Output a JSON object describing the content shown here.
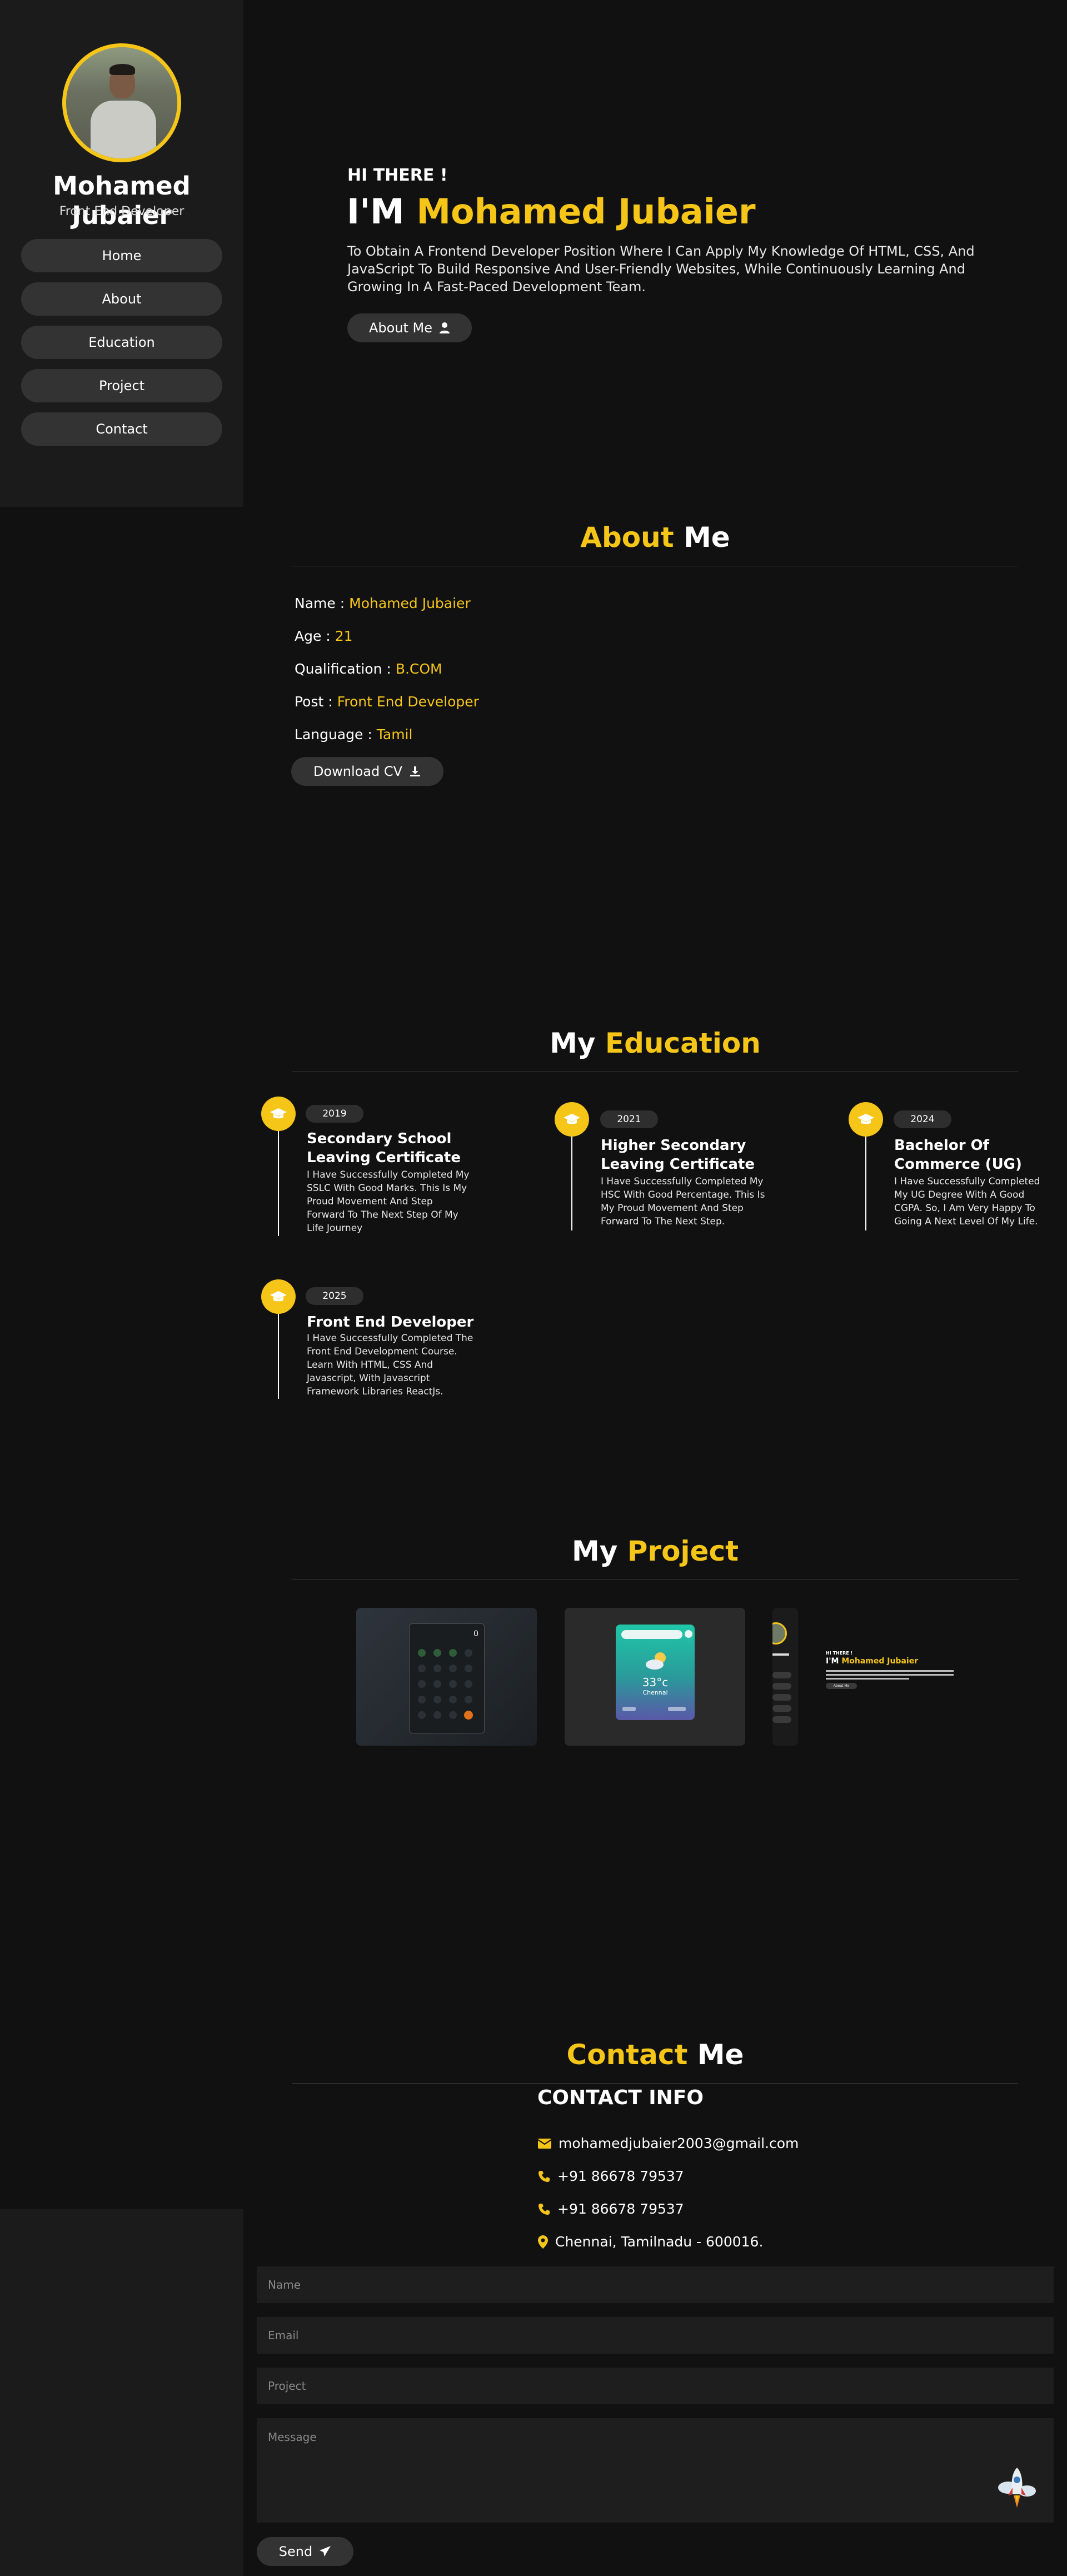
{
  "sidebar": {
    "name": "Mohamed Jubaier",
    "role": "Front End Developer",
    "nav": [
      "Home",
      "About",
      "Education",
      "Project",
      "Contact"
    ]
  },
  "hero": {
    "greeting": "HI THERE !",
    "title_prefix": "I'M",
    "title_name": "Mohamed Jubaier",
    "description": "To Obtain A Frontend Developer Position Where I Can Apply My Knowledge Of HTML, CSS, And JavaScript To Build Responsive And User-Friendly Websites, While Continuously Learning And Growing In A Fast-Paced Development Team.",
    "button": "About Me"
  },
  "about": {
    "title_accent": "About",
    "title_rest": "Me",
    "rows": [
      {
        "label": "Name :",
        "value": "Mohamed Jubaier"
      },
      {
        "label": "Age :",
        "value": "21"
      },
      {
        "label": "Qualification :",
        "value": "B.COM"
      },
      {
        "label": "Post :",
        "value": "Front End Developer"
      },
      {
        "label": "Language :",
        "value": "Tamil"
      }
    ],
    "download_button": "Download CV"
  },
  "education": {
    "title_rest": "My",
    "title_accent": "Education",
    "items": [
      {
        "year": "2019",
        "title": "Secondary School Leaving Certificate",
        "text": "I Have Successfully Completed My SSLC With Good Marks. This Is My Proud Movement And Step Forward To The Next Step Of My Life Journey"
      },
      {
        "year": "2021",
        "title": "Higher Secondary Leaving Certificate",
        "text": "I Have Successfully Completed My HSC With Good Percentage. This Is My Proud Movement And Step Forward To The Next Step."
      },
      {
        "year": "2024",
        "title": "Bachelor Of Commerce (UG)",
        "text": "I Have Successfully Completed My UG Degree With A Good CGPA. So, I Am Very Happy To Going A Next Level Of My Life."
      },
      {
        "year": "2025",
        "title": "Front End Developer",
        "text": "I Have Successfully Completed The Front End Development Course. Learn With HTML, CSS And Javascript, With Javascript Framework Libraries ReactJs."
      }
    ]
  },
  "projects": {
    "title_rest": "My",
    "title_accent": "Project",
    "calculator_display": "0",
    "weather_temp": "33°c",
    "weather_city": "Chennai",
    "portfolio_greeting": "HI THERE !",
    "portfolio_prefix": "I'M",
    "portfolio_name": "Mohamed Jubaier",
    "portfolio_button": "About Me"
  },
  "contact": {
    "title_accent": "Contact",
    "title_rest": "Me",
    "info_title": "CONTACT INFO",
    "email": "mohamedjubaier2003@gmail.com",
    "phone1": "+91 86678 79537",
    "phone2": "+91 86678 79537",
    "address": "Chennai, Tamilnadu - 600016.",
    "placeholders": {
      "name": "Name",
      "email": "Email",
      "project": "Project",
      "message": "Message"
    },
    "send_button": "Send"
  },
  "colors": {
    "accent": "#f5c518",
    "background": "#111111",
    "sidebar": "#1b1b1b"
  }
}
